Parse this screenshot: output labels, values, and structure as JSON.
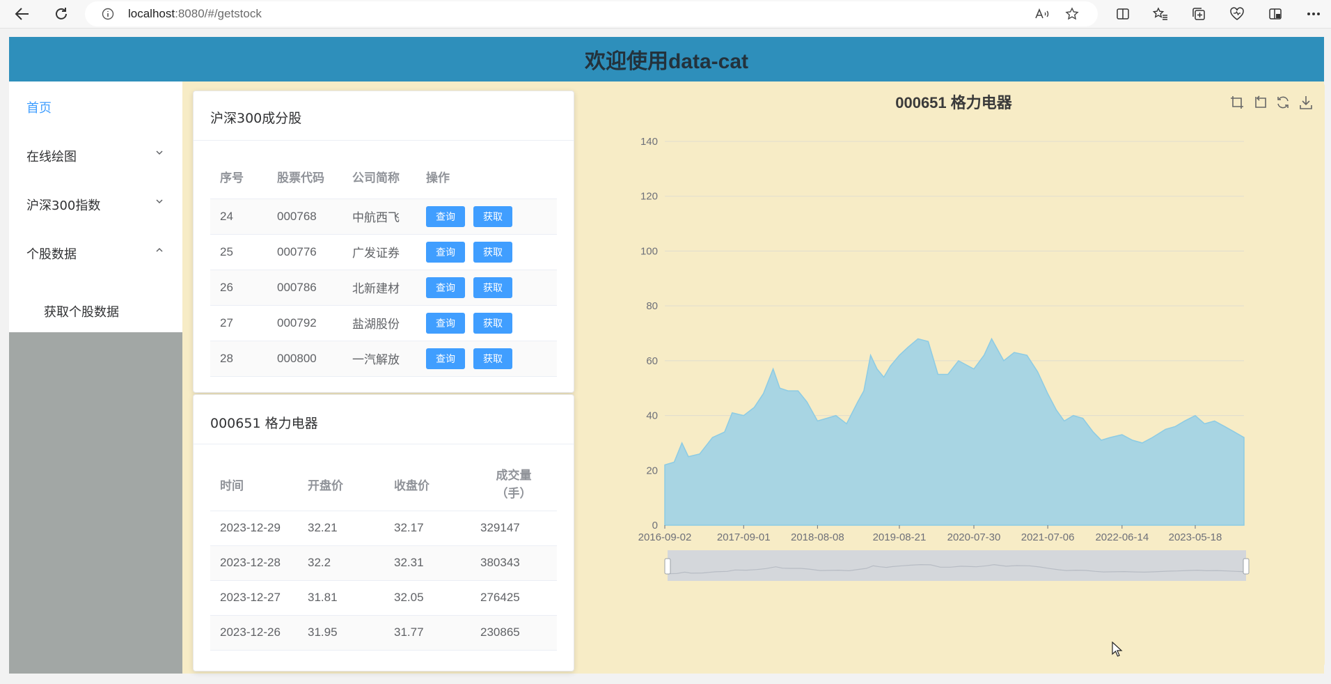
{
  "browser": {
    "url_host": "localhost",
    "url_rest": ":8080/#/getstock"
  },
  "app": {
    "title": "欢迎使用data-cat"
  },
  "sidebar": {
    "items": [
      {
        "label": "首页",
        "active": true
      },
      {
        "label": "在线绘图",
        "icon": "chevron-down-icon"
      },
      {
        "label": "沪深300指数",
        "icon": "chevron-down-icon"
      },
      {
        "label": "个股数据",
        "icon": "chevron-up-icon"
      }
    ],
    "subitems": [
      {
        "label": "获取个股数据"
      }
    ]
  },
  "stocks_card": {
    "title": "沪深300成分股",
    "columns": [
      "序号",
      "股票代码",
      "公司简称",
      "操作"
    ],
    "rows": [
      {
        "no": "24",
        "code": "000768",
        "name": "中航西飞"
      },
      {
        "no": "25",
        "code": "000776",
        "name": "广发证券"
      },
      {
        "no": "26",
        "code": "000786",
        "name": "北新建材"
      },
      {
        "no": "27",
        "code": "000792",
        "name": "盐湖股份"
      },
      {
        "no": "28",
        "code": "000800",
        "name": "一汽解放"
      }
    ],
    "query_label": "查询",
    "fetch_label": "获取"
  },
  "prices_card": {
    "title": "000651 格力电器",
    "columns": [
      "时间",
      "开盘价",
      "收盘价",
      "成交量",
      "（手）"
    ],
    "rows": [
      {
        "date": "2023-12-29",
        "open": "32.21",
        "close": "32.17",
        "volume": "329147"
      },
      {
        "date": "2023-12-28",
        "open": "32.2",
        "close": "32.31",
        "volume": "380343"
      },
      {
        "date": "2023-12-27",
        "open": "31.81",
        "close": "32.05",
        "volume": "276425"
      },
      {
        "date": "2023-12-26",
        "open": "31.95",
        "close": "31.77",
        "volume": "230865"
      }
    ]
  },
  "chart_data": {
    "type": "area",
    "title": "000651 格力电器",
    "ylim": [
      0,
      140
    ],
    "y_ticks": [
      0,
      20,
      40,
      60,
      80,
      100,
      120,
      140
    ],
    "x_range": [
      "2016-09-02",
      "2023-12-29"
    ],
    "x_ticks": [
      "2016-09-02",
      "2017-09-01",
      "2018-08-08",
      "2019-08-21",
      "2020-07-30",
      "2021-07-06",
      "2022-06-14",
      "2023-05-18"
    ],
    "grid": true,
    "series": [
      {
        "color": "#a8d5e3",
        "points": [
          [
            "2016-09-02",
            22
          ],
          [
            "2016-10-15",
            23
          ],
          [
            "2016-11-20",
            30
          ],
          [
            "2016-12-20",
            25
          ],
          [
            "2017-02-10",
            26
          ],
          [
            "2017-04-10",
            32
          ],
          [
            "2017-06-05",
            34
          ],
          [
            "2017-07-10",
            41
          ],
          [
            "2017-09-01",
            40
          ],
          [
            "2017-10-20",
            43
          ],
          [
            "2017-12-01",
            48
          ],
          [
            "2018-01-15",
            57
          ],
          [
            "2018-02-15",
            50
          ],
          [
            "2018-03-25",
            49
          ],
          [
            "2018-05-10",
            49
          ],
          [
            "2018-06-20",
            45
          ],
          [
            "2018-08-08",
            38
          ],
          [
            "2018-09-20",
            39
          ],
          [
            "2018-11-01",
            40
          ],
          [
            "2018-12-20",
            37
          ],
          [
            "2019-02-10",
            45
          ],
          [
            "2019-03-10",
            49
          ],
          [
            "2019-04-10",
            62
          ],
          [
            "2019-05-10",
            57
          ],
          [
            "2019-06-10",
            54
          ],
          [
            "2019-07-10",
            58
          ],
          [
            "2019-08-21",
            62
          ],
          [
            "2019-10-01",
            65
          ],
          [
            "2019-11-15",
            68
          ],
          [
            "2020-01-01",
            67
          ],
          [
            "2020-02-15",
            55
          ],
          [
            "2020-04-01",
            55
          ],
          [
            "2020-05-20",
            60
          ],
          [
            "2020-07-30",
            57
          ],
          [
            "2020-09-15",
            62
          ],
          [
            "2020-10-20",
            68
          ],
          [
            "2020-12-15",
            60
          ],
          [
            "2021-02-01",
            63
          ],
          [
            "2021-04-01",
            62
          ],
          [
            "2021-05-20",
            56
          ],
          [
            "2021-07-06",
            48
          ],
          [
            "2021-08-15",
            42
          ],
          [
            "2021-09-20",
            38
          ],
          [
            "2021-11-01",
            40
          ],
          [
            "2021-12-15",
            39
          ],
          [
            "2022-02-01",
            34
          ],
          [
            "2022-03-10",
            31
          ],
          [
            "2022-04-20",
            32
          ],
          [
            "2022-06-14",
            33
          ],
          [
            "2022-08-01",
            31
          ],
          [
            "2022-09-15",
            30
          ],
          [
            "2022-11-01",
            32
          ],
          [
            "2023-01-01",
            35
          ],
          [
            "2023-02-15",
            36
          ],
          [
            "2023-03-30",
            38
          ],
          [
            "2023-05-18",
            40
          ],
          [
            "2023-06-30",
            37
          ],
          [
            "2023-08-15",
            38
          ],
          [
            "2023-10-01",
            36
          ],
          [
            "2023-11-15",
            34
          ],
          [
            "2023-12-29",
            32
          ]
        ]
      }
    ]
  }
}
